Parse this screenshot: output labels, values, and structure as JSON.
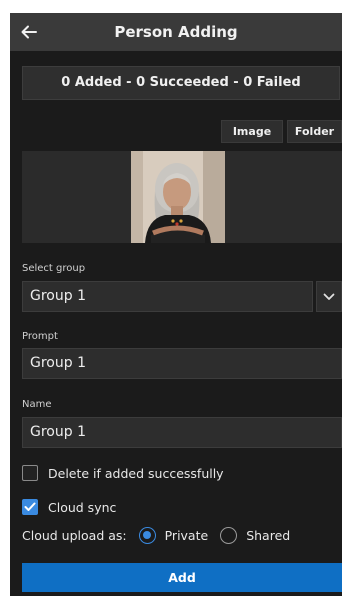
{
  "header": {
    "title": "Person Adding"
  },
  "status": {
    "summary": "0 Added - 0 Succeeded - 0 Failed"
  },
  "source_buttons": {
    "image_label": "Image",
    "folder_label": "Folder"
  },
  "form": {
    "group": {
      "label": "Select group",
      "value": "Group 1"
    },
    "prompt": {
      "label": "Prompt",
      "value": "Group 1"
    },
    "name": {
      "label": "Name",
      "value": "Group 1"
    },
    "delete_if_added": {
      "label": "Delete if added successfully",
      "checked": false
    },
    "cloud_sync": {
      "label": "Cloud sync",
      "checked": true
    },
    "cloud_upload": {
      "label": "Cloud upload as:",
      "options": [
        {
          "label": "Private",
          "selected": true
        },
        {
          "label": "Shared",
          "selected": false
        }
      ]
    }
  },
  "actions": {
    "add_label": "Add"
  },
  "colors": {
    "accent": "#3a8ae0",
    "button_primary": "#0f6fc4",
    "background": "#1b1b1b",
    "titlebar": "#3a3a3a"
  },
  "icons": {
    "back": "arrow-left-icon",
    "dropdown": "chevron-down-icon",
    "check": "checkmark-icon"
  }
}
